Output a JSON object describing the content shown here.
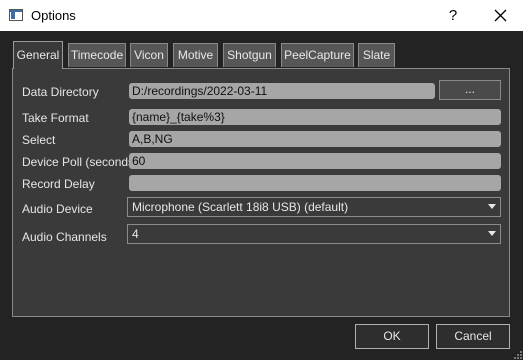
{
  "window": {
    "title": "Options",
    "help_label": "?"
  },
  "tabs": [
    {
      "label": "General",
      "active": true
    },
    {
      "label": "Timecode"
    },
    {
      "label": "Vicon"
    },
    {
      "label": "Motive"
    },
    {
      "label": "Shotgun"
    },
    {
      "label": "PeelCapture"
    },
    {
      "label": "Slate"
    }
  ],
  "general": {
    "data_directory": {
      "label": "Data Directory",
      "value": "D:/recordings/2022-03-11",
      "browse_label": "..."
    },
    "take_format": {
      "label": "Take Format",
      "value": "{name}_{take%3}"
    },
    "select": {
      "label": "Select",
      "value": "A,B,NG"
    },
    "device_poll": {
      "label": "Device Poll (seconds)",
      "value": "60"
    },
    "record_delay": {
      "label": "Record Delay",
      "value": ""
    },
    "audio_device": {
      "label": "Audio Device",
      "value": "Microphone (Scarlett 18i8 USB) (default)"
    },
    "audio_channels": {
      "label": "Audio Channels",
      "value": "4"
    }
  },
  "buttons": {
    "ok": "OK",
    "cancel": "Cancel"
  },
  "icons": {
    "app": "window-app-icon",
    "close": "close-icon",
    "dropdown": "chevron-down-icon"
  },
  "colors": {
    "panel": "#3a3a3a",
    "field": "#a6a6a6",
    "tab": "#565656"
  }
}
